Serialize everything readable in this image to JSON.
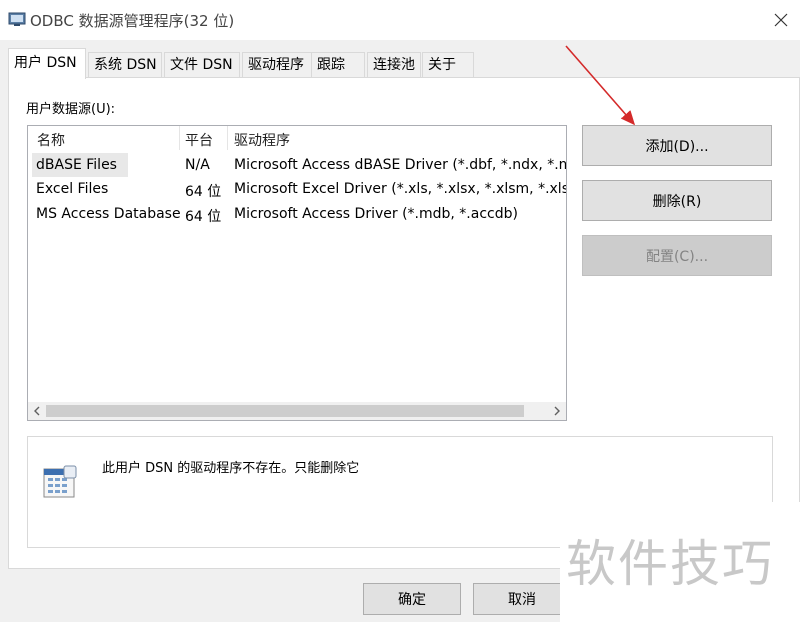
{
  "window": {
    "title": "ODBC 数据源管理程序(32 位)",
    "close_glyph": "✕"
  },
  "tabs": [
    {
      "label": "用户 DSN",
      "active": true
    },
    {
      "label": "系统 DSN",
      "active": false
    },
    {
      "label": "文件 DSN",
      "active": false
    },
    {
      "label": "驱动程序",
      "active": false
    },
    {
      "label": "跟踪",
      "active": false
    },
    {
      "label": "连接池",
      "active": false
    },
    {
      "label": "关于",
      "active": false
    }
  ],
  "page": {
    "group_label": "用户数据源(U):",
    "columns": [
      "名称",
      "平台",
      "驱动程序"
    ],
    "rows": [
      {
        "name": "dBASE Files",
        "platform": "N/A",
        "driver": "Microsoft Access dBASE Driver (*.dbf, *.ndx, *.mdx)",
        "selected": true
      },
      {
        "name": "Excel Files",
        "platform": "64 位",
        "driver": "Microsoft Excel Driver (*.xls, *.xlsx, *.xlsm, *.xlsb)",
        "selected": false
      },
      {
        "name": "MS Access Database",
        "platform": "64 位",
        "driver": "Microsoft Access Driver (*.mdb, *.accdb)",
        "selected": false
      }
    ],
    "scroll_left": "<",
    "scroll_right": ">",
    "buttons": {
      "add": "添加(D)...",
      "remove": "删除(R)",
      "configure": "配置(C)..."
    },
    "info_text": "此用户 DSN 的驱动程序不存在。只能删除它"
  },
  "footer": {
    "ok": "确定",
    "cancel": "取消"
  },
  "watermark": "软件技巧",
  "colors": {
    "annotation_arrow": "#d42a2a",
    "disabled_button": "#cccccc"
  }
}
